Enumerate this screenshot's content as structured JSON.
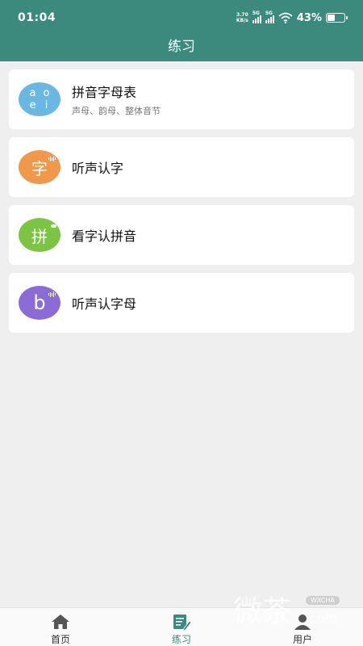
{
  "status_bar": {
    "time": "01:04",
    "net_speed_value": "3.70",
    "net_speed_unit": "KB/s",
    "signal1_label": "5G",
    "signal2_label": "5G",
    "battery_percent": "43%",
    "battery_level": 0.43
  },
  "header": {
    "title": "练习"
  },
  "items": [
    {
      "title": "拼音字母表",
      "subtitle": "声母、韵母、整体音节",
      "icon": "alphabet-icon",
      "icon_letters": [
        "a",
        "o",
        "e",
        "i"
      ],
      "color": "#6ab7e3"
    },
    {
      "title": "听声认字",
      "icon": "listen-character-icon",
      "icon_glyph": "字",
      "color": "#f0984c"
    },
    {
      "title": "看字认拼音",
      "icon": "read-pinyin-icon",
      "icon_glyph": "拼",
      "color": "#7cc444"
    },
    {
      "title": "听声认字母",
      "icon": "listen-letter-icon",
      "icon_glyph": "b",
      "color": "#8c6bd6"
    }
  ],
  "bottom_nav": {
    "active_color": "#3c8a7e",
    "items": [
      {
        "label": "首页",
        "icon": "home-icon",
        "active": false
      },
      {
        "label": "练习",
        "icon": "practice-icon",
        "active": true
      },
      {
        "label": "用户",
        "icon": "user-icon",
        "active": false
      }
    ]
  },
  "watermark": {
    "text": "微茶",
    "badge": "WXCHA",
    "suffix": ".com"
  }
}
